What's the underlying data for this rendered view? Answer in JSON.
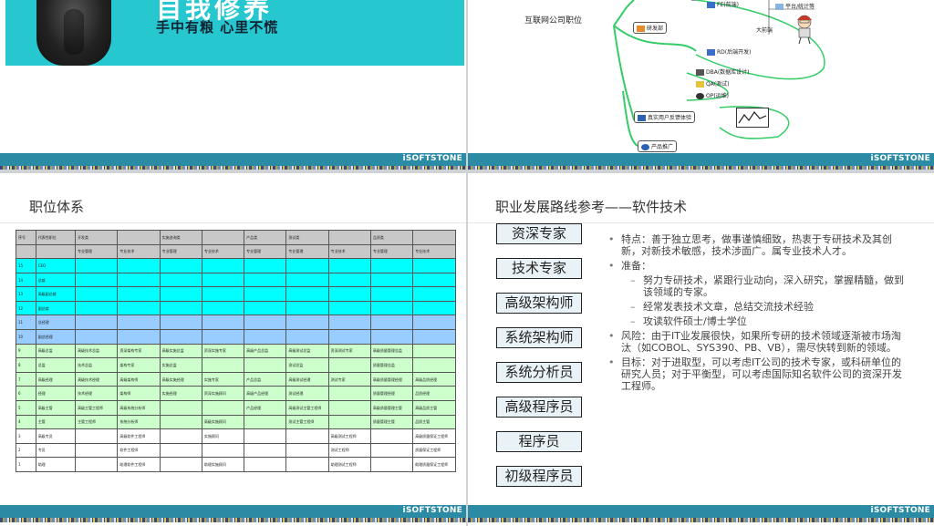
{
  "footer_logo": "iSOFTSTONE",
  "slide1": {
    "title": "自我修养",
    "subtitle": "手中有粮 心里不慌"
  },
  "slide2": {
    "title": "互联网公司职位",
    "nodes": {
      "fe": "FE(前端)",
      "platform": "平台/统计等",
      "bigdata": "大前端",
      "rd_dept": "研发部",
      "rd": "RD(后端开发)",
      "dba": "DBA(数据库设计)",
      "qa": "QA(测试)",
      "op": "OP(运维)",
      "ux": "真实用户反馈体验",
      "promo": "产品推广"
    }
  },
  "slide3": {
    "title": "职位体系",
    "header1": [
      "序号",
      "代表性职位",
      "开发类",
      "",
      "实施咨询类",
      "",
      "产品类",
      "测试类",
      "",
      "品质类",
      ""
    ],
    "header2": [
      "",
      "",
      "专业管理",
      "专业技术",
      "专业管理",
      "专业技术",
      "专业管理",
      "专业管理",
      "专业技术",
      "专业管理",
      "专业技术"
    ],
    "rows": [
      {
        "cls": "cy",
        "cells": [
          "15",
          "CEO",
          "",
          "",
          "",
          "",
          "",
          "",
          "",
          "",
          ""
        ]
      },
      {
        "cls": "cy",
        "cells": [
          "14",
          "总裁",
          "",
          "",
          "",
          "",
          "",
          "",
          "",
          "",
          ""
        ]
      },
      {
        "cls": "cy",
        "cells": [
          "13",
          "高级副总裁",
          "",
          "",
          "",
          "",
          "",
          "",
          "",
          "",
          ""
        ]
      },
      {
        "cls": "cy",
        "cells": [
          "12",
          "副总裁",
          "",
          "",
          "",
          "",
          "",
          "",
          "",
          "",
          ""
        ]
      },
      {
        "cls": "bl",
        "cells": [
          "11",
          "总经理",
          "",
          "",
          "",
          "",
          "",
          "",
          "",
          "",
          ""
        ]
      },
      {
        "cls": "bl",
        "cells": [
          "10",
          "副总经理",
          "",
          "",
          "",
          "",
          "",
          "",
          "",
          "",
          ""
        ]
      },
      {
        "cls": "gn",
        "cells": [
          "9",
          "高级总监",
          "高级技术总监",
          "资深架构专家",
          "高级实施总监",
          "资深实施专家",
          "高级产品总监",
          "高级测试总监",
          "资深测试专家",
          "高级质量管理总监",
          ""
        ]
      },
      {
        "cls": "gn",
        "cells": [
          "8",
          "总监",
          "技术总监",
          "架构专家",
          "实施总监",
          "",
          "",
          "测试总监",
          "",
          "质量管理总监",
          ""
        ]
      },
      {
        "cls": "gn",
        "cells": [
          "7",
          "高级经理",
          "高级技术经理",
          "高级架构师",
          "高级实施经理",
          "实施专家",
          "产品总监",
          "高级测试经理",
          "测试专家",
          "高级质量管理经理",
          "高级品质经理"
        ]
      },
      {
        "cls": "gn",
        "cells": [
          "6",
          "经理",
          "技术经理",
          "架构师",
          "实施经理",
          "资深实施顾问",
          "高级产品经理",
          "测试经理",
          "",
          "质量管理经理",
          "品质经理"
        ]
      },
      {
        "cls": "gn",
        "cells": [
          "5",
          "高级主管",
          "高级主管工程师",
          "高级系统分析师",
          "",
          "",
          "产品经理",
          "高级测试主管工程师",
          "",
          "高级质量管理主管",
          "高级品质主管"
        ]
      },
      {
        "cls": "gn",
        "cells": [
          "4",
          "主管",
          "主管工程师",
          "系统分析师",
          "",
          "高级实施顾问",
          "",
          "测试主管工程师",
          "",
          "质量管理主管",
          "品质主管"
        ]
      },
      {
        "cls": "wh",
        "cells": [
          "3",
          "高级专员",
          "",
          "高级软件工程师",
          "",
          "实施顾问",
          "",
          "",
          "高级测试工程师",
          "",
          "高级质量保证工程师"
        ]
      },
      {
        "cls": "wh",
        "cells": [
          "2",
          "专员",
          "",
          "软件工程师",
          "",
          "",
          "",
          "",
          "测试工程师",
          "",
          "质量保证工程师"
        ]
      },
      {
        "cls": "wh",
        "cells": [
          "1",
          "助理",
          "",
          "助理软件工程师",
          "",
          "助理实施顾问",
          "",
          "",
          "助理测试工程师",
          "",
          "助理质量保证工程师"
        ]
      }
    ]
  },
  "slide4": {
    "title": "职业发展路线参考——软件技术",
    "ladder": [
      "资深专家",
      "技术专家",
      "高级架构师",
      "系统架构师",
      "系统分析员",
      "高级程序员",
      "程序员",
      "初级程序员"
    ],
    "points": [
      {
        "type": "b",
        "text": "特点：善于独立思考，做事谨慎细致，热衷于专研技术及其创新，对新技术敏感，技术涉面广。属专业技术人才。"
      },
      {
        "type": "b",
        "text": "准备："
      },
      {
        "type": "d",
        "text": "努力专研技术，紧跟行业动向，深入研究，掌握精髓，做到该领域的专家。"
      },
      {
        "type": "d",
        "text": "经常发表技术文章，总结交流技术经验"
      },
      {
        "type": "d",
        "text": "攻读软件硕士/博士学位"
      },
      {
        "type": "b",
        "text": "风险：由于IT业发展很快，如果所专研的技术领域逐渐被市场淘汰（如COBOL、SYS390、PB、VB），需尽快转到新的领域。"
      },
      {
        "type": "b",
        "text": "目标：对于进取型，可以考虑IT公司的技术专家，或科研单位的研究人员；对于平衡型，可以考虑国际知名软件公司的资深开发工程师。"
      }
    ]
  }
}
